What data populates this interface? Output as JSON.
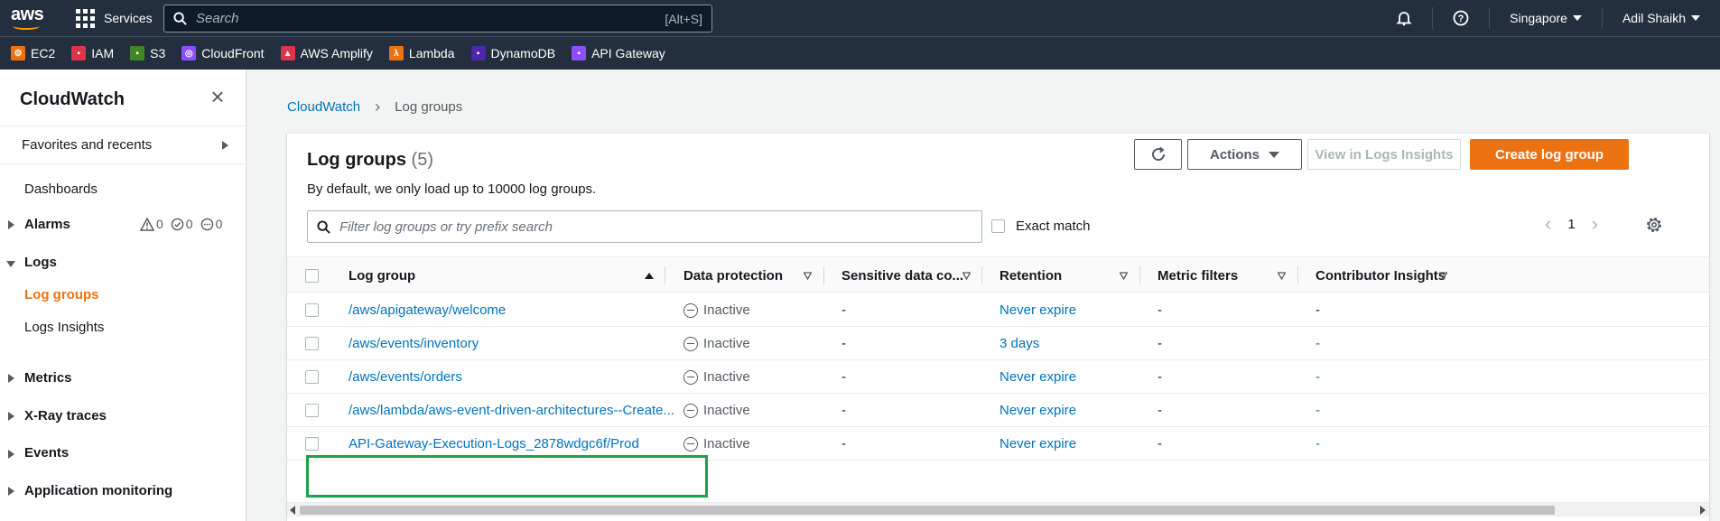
{
  "topnav": {
    "logo": "aws",
    "services_label": "Services",
    "search_placeholder": "Search",
    "search_hint": "[Alt+S]",
    "region": "Singapore",
    "user": "Adil Shaikh"
  },
  "favorites": [
    {
      "label": "EC2",
      "color": "#ec7211",
      "icon": "ec2-icon"
    },
    {
      "label": "IAM",
      "color": "#dd344c",
      "icon": "iam-icon"
    },
    {
      "label": "S3",
      "color": "#3f8624",
      "icon": "s3-icon"
    },
    {
      "label": "CloudFront",
      "color": "#8c4fff",
      "icon": "cloudfront-icon"
    },
    {
      "label": "AWS Amplify",
      "color": "#dd344c",
      "icon": "amplify-icon"
    },
    {
      "label": "Lambda",
      "color": "#ec7211",
      "icon": "lambda-icon"
    },
    {
      "label": "DynamoDB",
      "color": "#4d27aa",
      "icon": "dynamodb-icon"
    },
    {
      "label": "API Gateway",
      "color": "#8c4fff",
      "icon": "api-gateway-icon"
    }
  ],
  "sidebar": {
    "title": "CloudWatch",
    "favorites_label": "Favorites and recents",
    "dashboards": "Dashboards",
    "alarms": "Alarms",
    "alarm_counts": {
      "alarm": "0",
      "ok": "0",
      "insufficient": "0"
    },
    "logs": "Logs",
    "log_groups": "Log groups",
    "logs_insights": "Logs Insights",
    "metrics": "Metrics",
    "xray": "X-Ray traces",
    "events": "Events",
    "app_monitoring": "Application monitoring"
  },
  "breadcrumb": {
    "root": "CloudWatch",
    "current": "Log groups"
  },
  "panel": {
    "title": "Log groups",
    "count": "(5)",
    "description": "By default, we only load up to 10000 log groups.",
    "actions_label": "Actions",
    "view_insights_label": "View in Logs Insights",
    "create_label": "Create log group",
    "filter_placeholder": "Filter log groups or try prefix search",
    "exact_match_label": "Exact match",
    "page": "1"
  },
  "table": {
    "columns": [
      "Log group",
      "Data protection",
      "Sensitive data co...",
      "Retention",
      "Metric filters",
      "Contributor Insights"
    ],
    "rows": [
      {
        "name": "/aws/apigateway/welcome",
        "protection": "Inactive",
        "sensitive": "-",
        "retention": "Never expire",
        "metric": "-",
        "contributor": "-"
      },
      {
        "name": "/aws/events/inventory",
        "protection": "Inactive",
        "sensitive": "-",
        "retention": "3 days",
        "metric": "-",
        "contributor": "-"
      },
      {
        "name": "/aws/events/orders",
        "protection": "Inactive",
        "sensitive": "-",
        "retention": "Never expire",
        "metric": "-",
        "contributor": "-"
      },
      {
        "name": "/aws/lambda/aws-event-driven-architectures--Create...",
        "protection": "Inactive",
        "sensitive": "-",
        "retention": "Never expire",
        "metric": "-",
        "contributor": "-"
      },
      {
        "name": "API-Gateway-Execution-Logs_2878wdgc6f/Prod",
        "protection": "Inactive",
        "sensitive": "-",
        "retention": "Never expire",
        "metric": "-",
        "contributor": "-"
      }
    ]
  },
  "colors": {
    "accent": "#ec7211",
    "link": "#0073bb",
    "highlight": "#1aa34a",
    "nav_bg": "#232f3e"
  }
}
